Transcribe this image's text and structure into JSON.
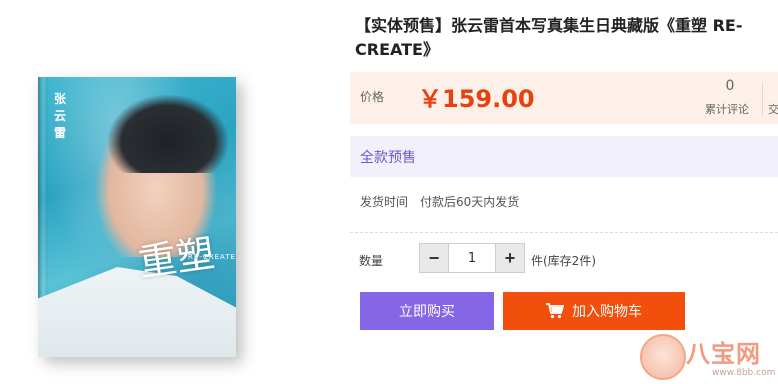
{
  "product": {
    "title": "【实体预售】张云雷首本写真集生日典藏版《重塑 RE-CREATE》",
    "cover": {
      "name_vertical": "张云雷",
      "title_art": "重塑",
      "subtitle": "RE-CREATE"
    }
  },
  "price": {
    "label": "价格",
    "value": "￥159.00",
    "review_count": "0",
    "review_label": "累计评论",
    "cut_label": "交"
  },
  "presale": {
    "title": "全款预售",
    "ship_label": "发货时间",
    "ship_value": "付款后60天内发货"
  },
  "quantity": {
    "label": "数量",
    "value": "1",
    "minus": "−",
    "plus": "+",
    "stock": "件(库存2件)"
  },
  "actions": {
    "buy_now": "立即购买",
    "add_to_cart": "加入购物车"
  },
  "watermark": {
    "text": "八宝网",
    "url": "www.8bb.com"
  },
  "colors": {
    "price": "#e8410f",
    "buy_button": "#8466e6",
    "cart_button": "#f24e0c",
    "presale_accent": "#6a5acd"
  }
}
